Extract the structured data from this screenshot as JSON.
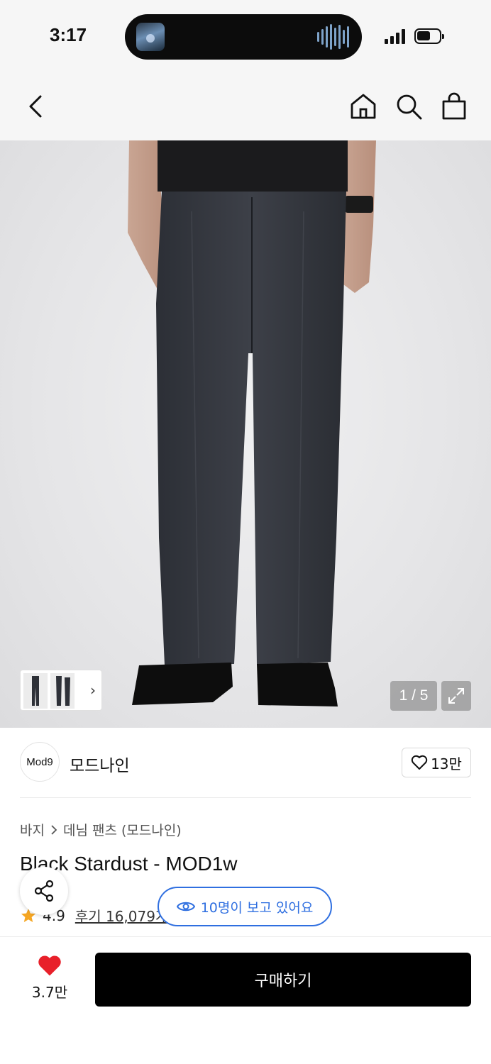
{
  "status_bar": {
    "time": "3:17"
  },
  "nav": {
    "back": "back-icon",
    "home": "home-icon",
    "search": "search-icon",
    "bag": "shopping-bag-icon"
  },
  "gallery": {
    "counter": "1 / 5",
    "current": 1,
    "total": 5
  },
  "brand": {
    "logo_text": "Mod9",
    "name": "모드나인",
    "like_count": "13만"
  },
  "product": {
    "breadcrumb": [
      "바지",
      "데님 팬츠 (모드나인)"
    ],
    "title": "Black Stardust - MOD1w",
    "rating": "4.9",
    "reviews": "후기 16,079개"
  },
  "overlay": {
    "viewers": "10명이 보고 있어요"
  },
  "bottom": {
    "like_count": "3.7만",
    "buy_label": "구매하기"
  },
  "colors": {
    "accent_blue": "#2f6fe0",
    "heart_red": "#e8202a",
    "star": "#f5a623"
  }
}
